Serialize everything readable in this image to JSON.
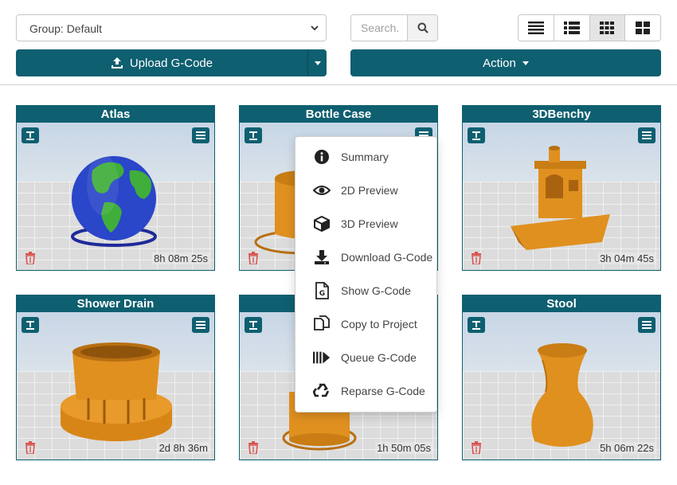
{
  "toolbar": {
    "group_select": "Group: Default",
    "search_placeholder": "Search.",
    "upload_label": "Upload G-Code",
    "action_label": "Action"
  },
  "cards": [
    {
      "title": "Atlas",
      "time": "8h 08m 25s"
    },
    {
      "title": "Bottle Case",
      "time": ""
    },
    {
      "title": "3DBenchy",
      "time": "3h 04m 45s"
    },
    {
      "title": "Shower Drain",
      "time": "2d 8h 36m"
    },
    {
      "title": "",
      "time": "1h 50m 05s"
    },
    {
      "title": "Stool",
      "time": "5h 06m 22s"
    }
  ],
  "menu": {
    "items": [
      {
        "label": "Summary",
        "icon": "info-icon"
      },
      {
        "label": "2D Preview",
        "icon": "eye-icon"
      },
      {
        "label": "3D Preview",
        "icon": "cube-icon"
      },
      {
        "label": "Download G-Code",
        "icon": "download-icon"
      },
      {
        "label": "Show G-Code",
        "icon": "file-g-icon"
      },
      {
        "label": "Copy to Project",
        "icon": "copy-icon"
      },
      {
        "label": "Queue G-Code",
        "icon": "queue-icon"
      },
      {
        "label": "Reparse G-Code",
        "icon": "recycle-icon"
      }
    ]
  },
  "colors": {
    "accent": "#0e5f70",
    "filament": "#e0901f",
    "trash": "#d9534f"
  }
}
